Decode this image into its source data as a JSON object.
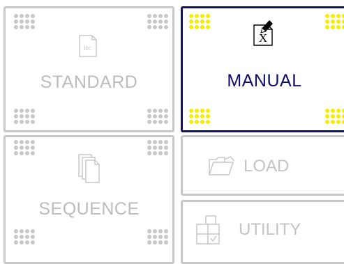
{
  "tiles": {
    "standard": {
      "label": "STANDARD",
      "icon_text": "IEC",
      "icon": "iec-document-icon",
      "selected": false
    },
    "manual": {
      "label": "MANUAL",
      "icon_text": "X",
      "icon": "manual-edit-icon",
      "selected": true
    },
    "sequence": {
      "label": "SEQUENCE",
      "icon": "copy-pages-icon",
      "selected": false
    },
    "load": {
      "label": "LOAD",
      "icon": "open-folder-icon",
      "selected": false
    },
    "utility": {
      "label": "UTILITY",
      "icon": "utility-blocks-icon",
      "selected": false
    }
  },
  "colors": {
    "selected_border": "#10106a",
    "selected_dots": "#f6ee00",
    "disabled": "#c8c8c8"
  }
}
